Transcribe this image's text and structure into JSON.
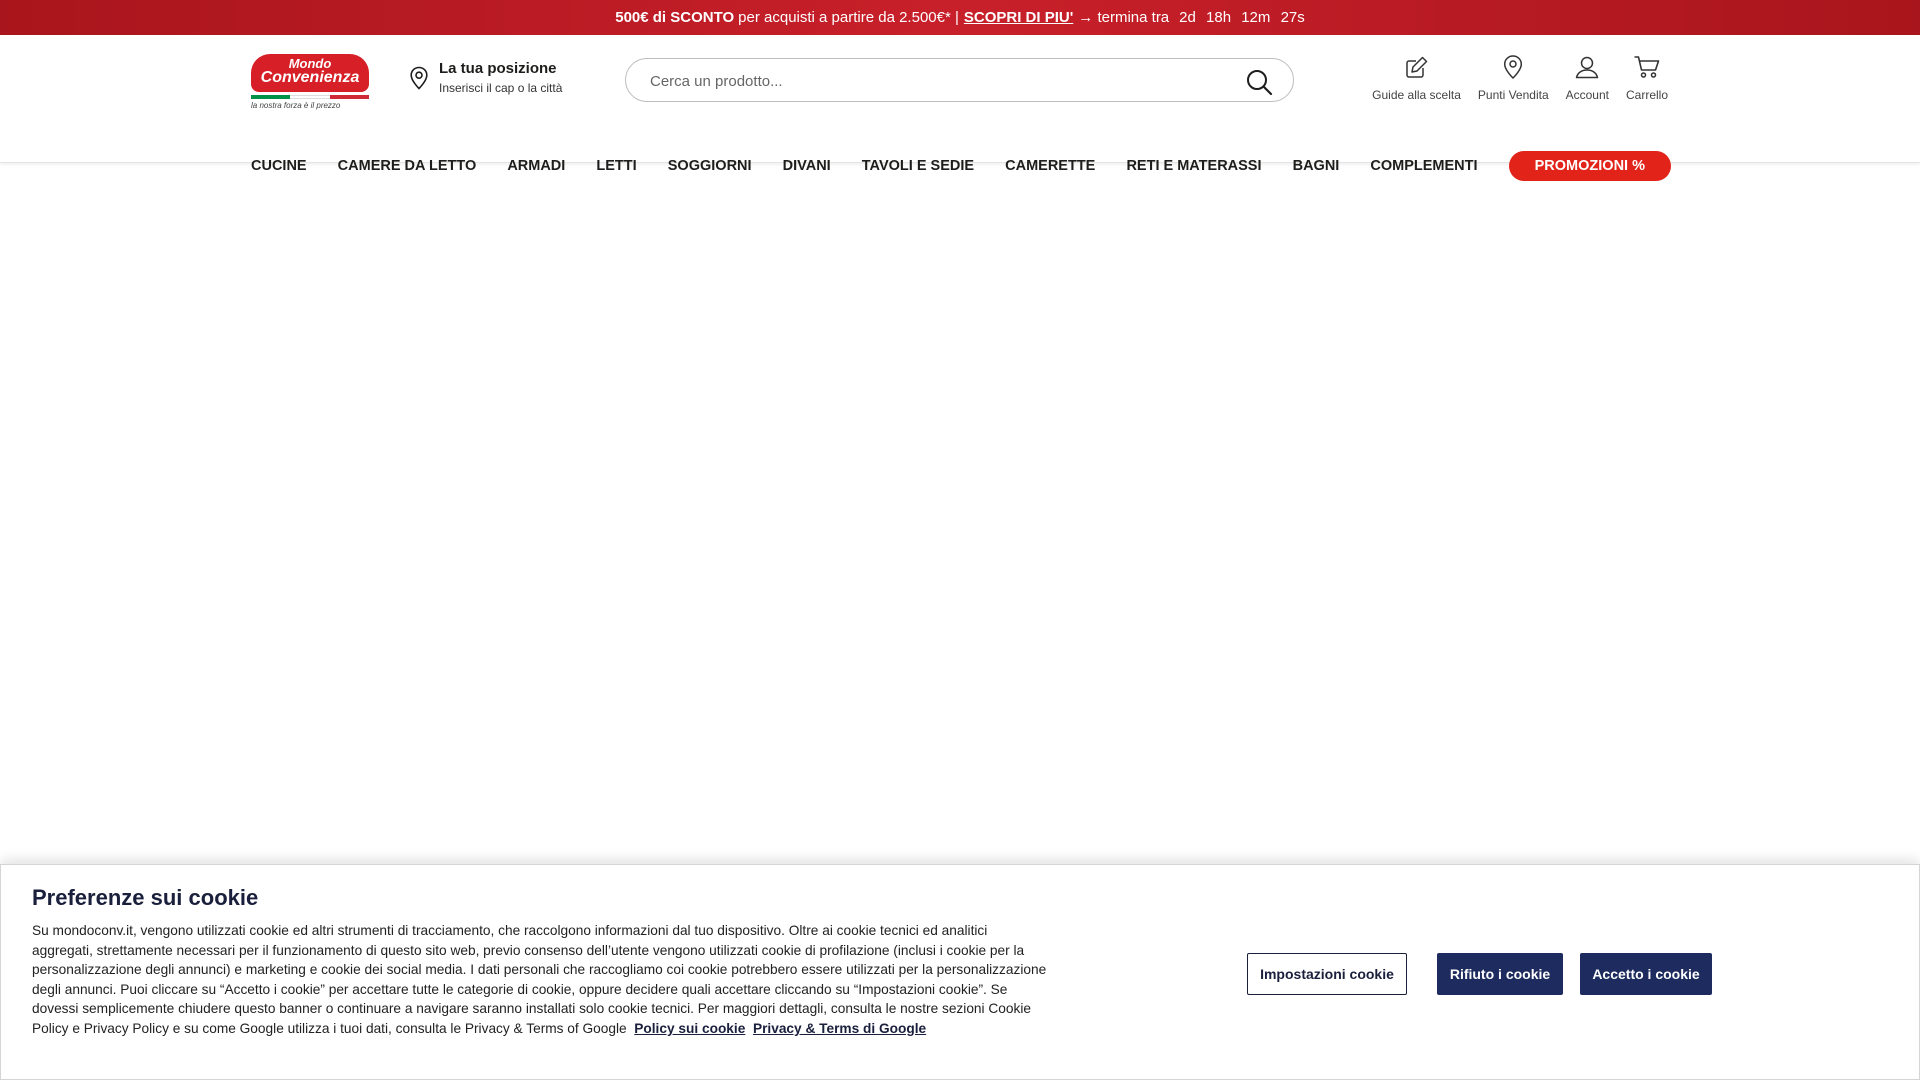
{
  "promo": {
    "highlight": "500€ di SCONTO",
    "text": "per acquisti a partire da 2.500€* |",
    "link": "SCOPRI DI PIU'",
    "countdown_prefix": "→ termina tra",
    "days": "2d",
    "hours": "18h",
    "minutes": "12m",
    "seconds": "27s"
  },
  "logo": {
    "line1": "Mondo",
    "line2": "Convenienza",
    "tagline": "la nostra forza è il prezzo"
  },
  "location": {
    "title": "La tua posizione",
    "subtitle": "Inserisci il cap o la città"
  },
  "search": {
    "placeholder": "Cerca un prodotto..."
  },
  "header_icons": [
    {
      "label": "Guide alla scelta",
      "icon": "pencil-square-icon"
    },
    {
      "label": "Punti Vendita",
      "icon": "map-pin-icon"
    },
    {
      "label": "Account",
      "icon": "user-icon"
    },
    {
      "label": "Carrello",
      "icon": "cart-icon"
    }
  ],
  "nav": {
    "items": [
      "CUCINE",
      "CAMERE DA LETTO",
      "ARMADI",
      "LETTI",
      "SOGGIORNI",
      "DIVANI",
      "TAVOLI E SEDIE",
      "CAMERETTE",
      "RETI E MATERASSI",
      "BAGNI",
      "COMPLEMENTI"
    ],
    "promo": "PROMOZIONI %"
  },
  "cookie": {
    "title": "Preferenze sui cookie",
    "body": "Su mondoconv.it, vengono utilizzati cookie ed altri strumenti di tracciamento, che raccolgono informazioni dal tuo dispositivo. Oltre ai cookie tecnici ed analitici aggregati, strettamente necessari per il funzionamento di questo sito web, previo consenso dell’utente vengono utilizzati cookie di profilazione (inclusi i cookie per la personalizzazione degli annunci) e marketing e cookie dei social media. I dati personali che raccogliamo coi cookie potrebbero essere utilizzati per la personalizzazione degli annunci. Puoi cliccare su “Accetto i cookie” per accettare tutte le categorie di cookie, oppure decidere quali accettare cliccando su “Impostazioni cookie”. Se dovessi semplicemente chiudere questo banner o continuare a navigare saranno installati solo cookie tecnici. Per maggiori dettagli, consulta le nostre sezioni Cookie Policy e Privacy Policy e su come Google utilizza i tuoi dati, consulta le Privacy & Terms of Google",
    "policy_link": "Policy sui cookie",
    "google_link": "Privacy & Terms di Google",
    "settings_button": "Impostazioni cookie",
    "reject_button": "Rifiuto i cookie",
    "accept_button": "Accetto i cookie"
  },
  "colors": {
    "brand_red": "#d61f26",
    "promo_button": "#e2231a",
    "cookie_navy": "#1e2b5e"
  }
}
